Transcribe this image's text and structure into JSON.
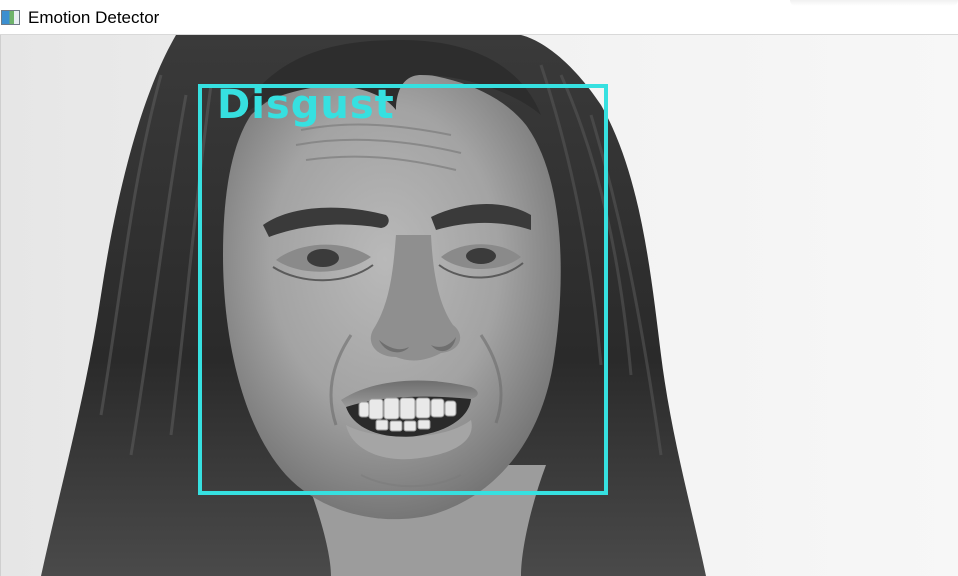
{
  "window": {
    "title": "Emotion Detector",
    "app_icon": "window-app-icon"
  },
  "detection": {
    "label": "Disgust",
    "box_color": "#36e0e0"
  }
}
